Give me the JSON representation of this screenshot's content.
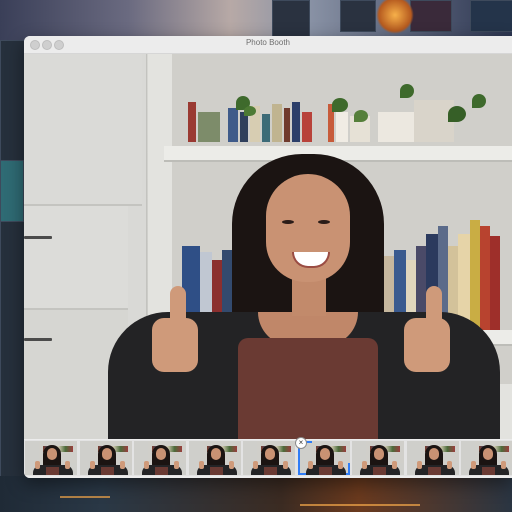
{
  "window": {
    "title": "Photo Booth"
  },
  "filmstrip": {
    "thumbnail_count": 9,
    "selected_index": 5,
    "delete_glyph": "×"
  },
  "toolbar": {
    "shutter_icon": "camera-icon"
  },
  "colors": {
    "selection": "#2f7cf6",
    "window_chrome": "#ececec"
  }
}
